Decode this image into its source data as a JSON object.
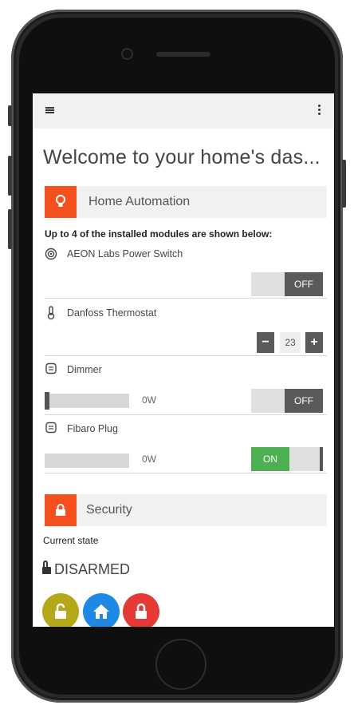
{
  "colors": {
    "accent": "#f4511e",
    "toggle_on": "#4caf50",
    "toggle_off": "#5a5a5a",
    "disarm": "#b5a818",
    "home": "#1e88e5",
    "arm": "#e53935"
  },
  "header": {
    "title": "Welcome to your home's das..."
  },
  "home_automation": {
    "section_label": "Home Automation",
    "icon": "lightbulb-icon",
    "info": "Up to 4 of the installed modules are shown below:",
    "modules": [
      {
        "name": "AEON Labs Power Switch",
        "icon": "power-switch-icon",
        "toggle": "OFF"
      },
      {
        "name": "Danfoss Thermostat",
        "icon": "thermometer-icon",
        "setpoint": "23",
        "minus": "−",
        "plus": "+"
      },
      {
        "name": "Dimmer",
        "icon": "plug-icon",
        "watts": "0W",
        "level": 0,
        "toggle": "OFF"
      },
      {
        "name": "Fibaro Plug",
        "icon": "plug-icon",
        "watts": "0W",
        "toggle": "ON"
      }
    ]
  },
  "security": {
    "section_label": "Security",
    "icon": "lock-icon",
    "state_label": "Current state",
    "state_value": "DISARMED",
    "buttons": [
      {
        "name": "disarm",
        "icon": "unlock-icon"
      },
      {
        "name": "home",
        "icon": "home-icon"
      },
      {
        "name": "arm",
        "icon": "lock-icon"
      }
    ]
  }
}
